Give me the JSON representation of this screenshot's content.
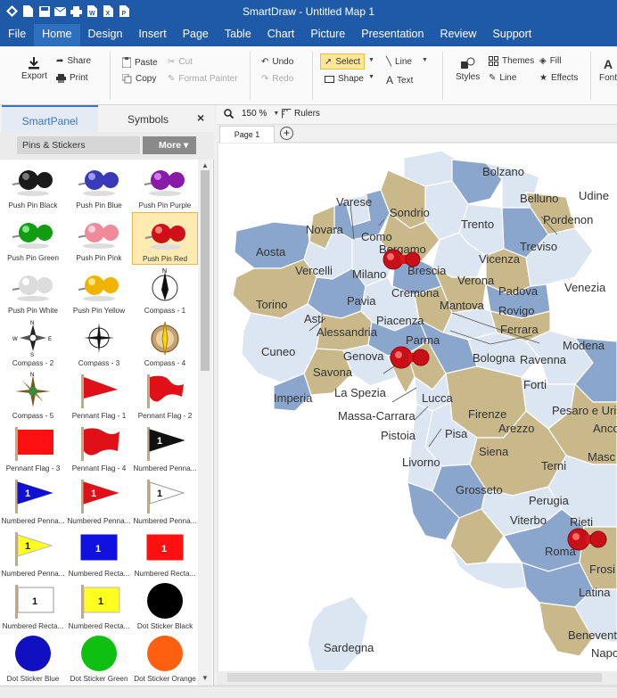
{
  "window": {
    "title": "SmartDraw - Untitled Map 1"
  },
  "menu": [
    "File",
    "Home",
    "Design",
    "Insert",
    "Page",
    "Table",
    "Chart",
    "Picture",
    "Presentation",
    "Review",
    "Support"
  ],
  "active_menu": "Home",
  "ribbon": {
    "export": "Export",
    "share": "Share",
    "print": "Print",
    "paste": "Paste",
    "cut": "Cut",
    "copy": "Copy",
    "format_painter": "Format Painter",
    "undo": "Undo",
    "redo": "Redo",
    "select": "Select",
    "shape": "Shape",
    "line": "Line",
    "text": "Text",
    "styles": "Styles",
    "themes": "Themes",
    "line2": "Line",
    "fill": "Fill",
    "effects": "Effects",
    "font": "Font"
  },
  "panel": {
    "tab_smartpanel": "SmartPanel",
    "tab_symbols": "Symbols",
    "close": "×",
    "library": "Pins & Stickers",
    "more": "More ▾"
  },
  "symbols": [
    "Push Pin Black",
    "Push Pin Blue",
    "Push Pin Purple",
    "Push Pin Green",
    "Push Pin Pink",
    "Push Pin Red",
    "Push Pin White",
    "Push Pin Yellow",
    "Compass - 1",
    "Compass - 2",
    "Compass - 3",
    "Compass - 4",
    "Compass - 5",
    "Pennant Flag - 1",
    "Pennant Flag - 2",
    "Pennant Flag - 3",
    "Pennant Flag - 4",
    "Numbered Penna...",
    "Numbered Penna...",
    "Numbered Penna...",
    "Numbered Penna...",
    "Numbered Penna...",
    "Numbered Recta...",
    "Numbered Recta...",
    "Numbered Recta...",
    "Numbered Recta...",
    "Dot Sticker Black",
    "Dot Sticker Blue",
    "Dot Sticker Green",
    "Dot Sticker Orange"
  ],
  "selected_symbol": "Push Pin Red",
  "number_glyph": "1",
  "compass_letters": {
    "n": "N",
    "s": "S",
    "e": "E",
    "w": "W"
  },
  "canvas": {
    "zoom": "150 %",
    "rulers": "Rulers",
    "page_tab": "Page 1",
    "add_page": "+"
  },
  "map_labels": {
    "bolzano": "Bolzano",
    "belluno": "Belluno",
    "udine": "Udine",
    "varese": "Varese",
    "sondrio": "Sondrio",
    "trento": "Trento",
    "pordenon": "Pordenon",
    "novara": "Novara",
    "como": "Como",
    "bergamo": "Bergamo",
    "aosta": "Aosta",
    "treviso": "Treviso",
    "vicenza": "Vicenza",
    "brescia": "Brescia",
    "vercelli": "Vercelli",
    "milano": "Milano",
    "verona": "Verona",
    "padova": "Padova",
    "venezia": "Venezia",
    "cremona": "Cremona",
    "torino": "Torino",
    "pavia": "Pavia",
    "mantova": "Mantova",
    "rovigo": "Rovigo",
    "asti": "Asti",
    "piacenza": "Piacenza",
    "ferrara": "Ferrara",
    "alessandria": "Alessandria",
    "parma": "Parma",
    "modena": "Modena",
    "cuneo": "Cuneo",
    "genova": "Genova",
    "bologna": "Bologna",
    "ravenna": "Ravenna",
    "savona": "Savona",
    "forti": "Forti",
    "imperia": "Imperia",
    "la_spezia": "La Spezia",
    "lucca": "Lucca",
    "massa_carrara": "Massa-Carrara",
    "firenze": "Firenze",
    "pesaro": "Pesaro e Uri",
    "arezzo": "Arezzo",
    "anco": "Anco",
    "pistoia": "Pistoia",
    "pisa": "Pisa",
    "livorno": "Livorno",
    "siena": "Siena",
    "terni": "Terni",
    "masc": "Masc",
    "grosseto": "Grosseto",
    "perugia": "Perugia",
    "viterbo": "Viterbo",
    "rieti": "Rieti",
    "roma": "Roma",
    "frosi": "Frosi",
    "latina": "Latina",
    "sardegna": "Sardegna",
    "benevent": "Benevent",
    "napo": "Napo"
  },
  "colors": {
    "title_bar": "#1e5aa8",
    "accent": "#3b73b9",
    "selected_cell": "#fdebb2",
    "select_button": "#ffe79a",
    "map_blue": "#8aa6cc",
    "map_tan": "#c9b98a",
    "map_pale": "#dce6f2",
    "pin_red": "#d01018"
  }
}
